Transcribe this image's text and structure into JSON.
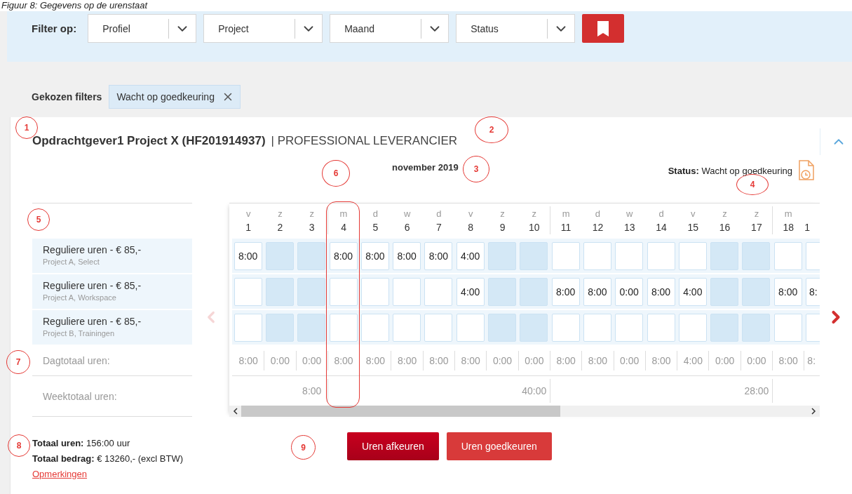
{
  "caption": "Figuur 8: Gegevens op de urenstaat",
  "filter_bar": {
    "label": "Filter op:",
    "dropdowns": [
      {
        "label": "Profiel"
      },
      {
        "label": "Project"
      },
      {
        "label": "Maand"
      },
      {
        "label": "Status"
      }
    ]
  },
  "chosen_filters": {
    "label": "Gekozen filters",
    "chips": [
      {
        "label": "Wacht op goedkeuring"
      }
    ]
  },
  "timesheet": {
    "title": "Opdrachtgever1 Project X (HF201914937)",
    "role": "| PROFESSIONAL LEVERANCIER",
    "month": "november 2019",
    "status_label": "Status:",
    "status_value": "Wacht op goedkeuring",
    "expanded": true
  },
  "days": [
    {
      "weekday": "v",
      "number": "1",
      "weekend": false,
      "week_start": false
    },
    {
      "weekday": "z",
      "number": "2",
      "weekend": true,
      "week_start": false
    },
    {
      "weekday": "z",
      "number": "3",
      "weekend": true,
      "week_start": false
    },
    {
      "weekday": "m",
      "number": "4",
      "weekend": false,
      "week_start": true
    },
    {
      "weekday": "d",
      "number": "5",
      "weekend": false,
      "week_start": false
    },
    {
      "weekday": "w",
      "number": "6",
      "weekend": false,
      "week_start": false
    },
    {
      "weekday": "d",
      "number": "7",
      "weekend": false,
      "week_start": false
    },
    {
      "weekday": "v",
      "number": "8",
      "weekend": false,
      "week_start": false
    },
    {
      "weekday": "z",
      "number": "9",
      "weekend": true,
      "week_start": false
    },
    {
      "weekday": "z",
      "number": "10",
      "weekend": true,
      "week_start": false
    },
    {
      "weekday": "m",
      "number": "11",
      "weekend": false,
      "week_start": true
    },
    {
      "weekday": "d",
      "number": "12",
      "weekend": false,
      "week_start": false
    },
    {
      "weekday": "w",
      "number": "13",
      "weekend": false,
      "week_start": false
    },
    {
      "weekday": "d",
      "number": "14",
      "weekend": false,
      "week_start": false
    },
    {
      "weekday": "v",
      "number": "15",
      "weekend": false,
      "week_start": false
    },
    {
      "weekday": "z",
      "number": "16",
      "weekend": true,
      "week_start": false
    },
    {
      "weekday": "z",
      "number": "17",
      "weekend": true,
      "week_start": false
    },
    {
      "weekday": "m",
      "number": "18",
      "weekend": false,
      "week_start": true
    },
    {
      "number": "1",
      "weekend": false,
      "week_start": false
    }
  ],
  "rows": [
    {
      "title": "Reguliere uren - € 85,-",
      "subtitle": "Project A, Select",
      "cells": [
        {
          "kind": "entry",
          "value": "8:00"
        },
        {
          "kind": "empty"
        },
        {
          "kind": "empty"
        },
        {
          "kind": "entry",
          "value": "8:00"
        },
        {
          "kind": "entry",
          "value": "8:00"
        },
        {
          "kind": "entry",
          "value": "8:00"
        },
        {
          "kind": "entry",
          "value": "8:00"
        },
        {
          "kind": "entry",
          "value": "4:00"
        },
        {
          "kind": "empty"
        },
        {
          "kind": "empty"
        },
        {
          "kind": "empty"
        },
        {
          "kind": "empty"
        },
        {
          "kind": "empty"
        },
        {
          "kind": "empty"
        },
        {
          "kind": "empty"
        },
        {
          "kind": "empty"
        },
        {
          "kind": "empty"
        },
        {
          "kind": "empty"
        },
        {
          "kind": "empty"
        }
      ]
    },
    {
      "title": "Reguliere uren - € 85,-",
      "subtitle": "Project A, Workspace",
      "cells": [
        {
          "kind": "empty"
        },
        {
          "kind": "empty"
        },
        {
          "kind": "empty"
        },
        {
          "kind": "empty"
        },
        {
          "kind": "empty"
        },
        {
          "kind": "empty"
        },
        {
          "kind": "empty"
        },
        {
          "kind": "entry",
          "value": "4:00"
        },
        {
          "kind": "empty"
        },
        {
          "kind": "empty"
        },
        {
          "kind": "entry",
          "value": "8:00"
        },
        {
          "kind": "entry",
          "value": "8:00"
        },
        {
          "kind": "entry",
          "value": "0:00"
        },
        {
          "kind": "entry",
          "value": "8:00"
        },
        {
          "kind": "entry",
          "value": "4:00"
        },
        {
          "kind": "empty"
        },
        {
          "kind": "empty"
        },
        {
          "kind": "entry",
          "value": "8:00"
        },
        {
          "kind": "entry",
          "value": "8:"
        }
      ]
    },
    {
      "title": "Reguliere uren - € 85,-",
      "subtitle": "Project B, Trainingen",
      "cells": [
        {
          "kind": "empty"
        },
        {
          "kind": "empty"
        },
        {
          "kind": "empty"
        },
        {
          "kind": "empty"
        },
        {
          "kind": "empty"
        },
        {
          "kind": "empty"
        },
        {
          "kind": "empty"
        },
        {
          "kind": "empty"
        },
        {
          "kind": "empty"
        },
        {
          "kind": "empty"
        },
        {
          "kind": "empty"
        },
        {
          "kind": "empty"
        },
        {
          "kind": "empty"
        },
        {
          "kind": "empty"
        },
        {
          "kind": "empty"
        },
        {
          "kind": "empty"
        },
        {
          "kind": "empty"
        },
        {
          "kind": "empty"
        },
        {
          "kind": "empty"
        }
      ]
    }
  ],
  "day_totals": {
    "label": "Dagtotaal uren:",
    "values": [
      "8:00",
      "0:00",
      "0:00",
      "8:00",
      "8:00",
      "8:00",
      "8:00",
      "8:00",
      "0:00",
      "0:00",
      "8:00",
      "8:00",
      "0:00",
      "8:00",
      "4:00",
      "0:00",
      "0:00",
      "8:00",
      "8:"
    ]
  },
  "week_totals": {
    "label": "Weektotaal uren:",
    "values": [
      "8:00",
      "40:00",
      "28:00"
    ]
  },
  "navigation": {
    "previous_disabled": true,
    "next_disabled": false
  },
  "summary": {
    "lines": [
      "**Totaal uren:** 156:00 uur",
      "**Totaal bedrag:** € 13260,- (excl BTW)"
    ],
    "link": "Opmerkingen"
  },
  "actions": [
    {
      "label": "Uren afkeuren",
      "kind": "primary"
    },
    {
      "label": "Uren goedkeuren",
      "kind": "secondary"
    }
  ],
  "annotations": [
    {
      "kind": "marker",
      "label": "1"
    },
    {
      "kind": "marker",
      "label": "2"
    },
    {
      "kind": "marker",
      "label": "3"
    },
    {
      "kind": "marker",
      "label": "4"
    },
    {
      "kind": "marker",
      "label": "5"
    },
    {
      "kind": "marker",
      "label": "6"
    },
    {
      "kind": "marker",
      "label": "7"
    },
    {
      "kind": "marker",
      "label": "8"
    },
    {
      "kind": "marker",
      "label": "9"
    },
    {
      "kind": "frame"
    }
  ]
}
